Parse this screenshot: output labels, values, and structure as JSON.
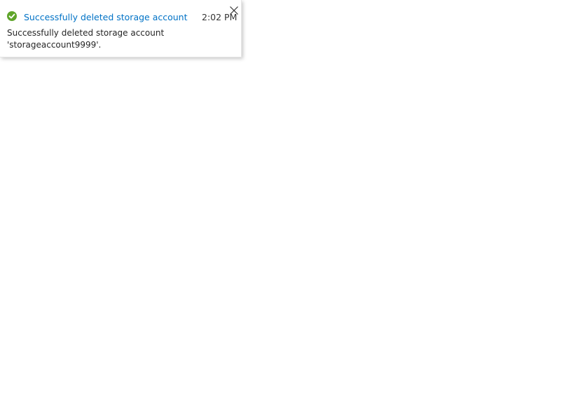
{
  "notification": {
    "status": "success",
    "status_icon": "check-circle-icon",
    "title": "Successfully deleted storage account",
    "time": "2:02 PM",
    "message": "Successfully deleted storage account 'storageaccount9999'.",
    "close_icon": "close-icon"
  },
  "colors": {
    "title": "#0072c6",
    "success": "#5fa52a",
    "text": "#262626"
  }
}
